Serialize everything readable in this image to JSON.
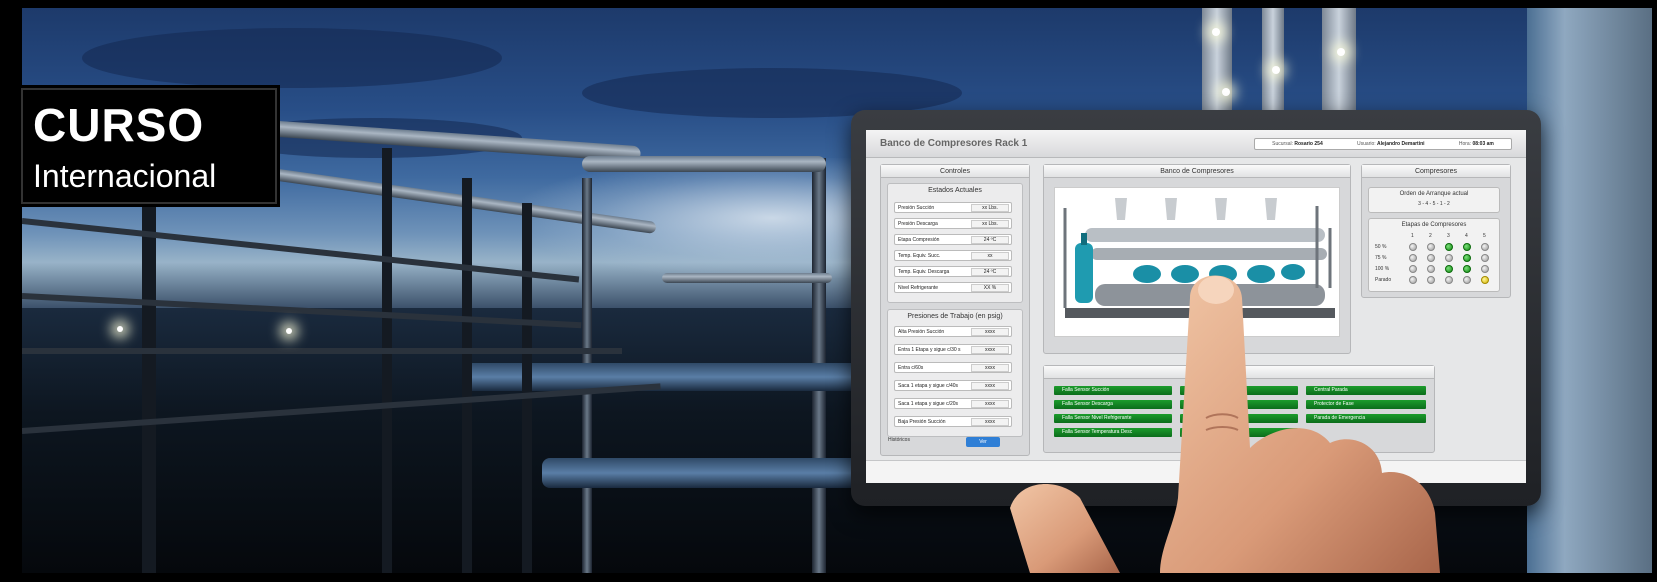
{
  "badge": {
    "title": "CURSO",
    "subtitle": "Internacional"
  },
  "app": {
    "title": "Banco de Compresores Rack 1",
    "info": {
      "sucursal_label": "Sucursal:",
      "sucursal": "Rosario 254",
      "usuario_label": "Usuario:",
      "usuario": "Alejandro Demartini",
      "hora_label": "Hora:",
      "hora": "08:03 am"
    }
  },
  "controles": {
    "title": "Controles",
    "estados": {
      "title": "Estados Actuales",
      "fields": [
        {
          "label": "Presión Succión",
          "value": "xx Lbs."
        },
        {
          "label": "Presión Descarga",
          "value": "xx Lbs."
        },
        {
          "label": "Etapa Compresión",
          "value": "24 ºC"
        },
        {
          "label": "Temp. Equiv. Succ.",
          "value": "xx"
        },
        {
          "label": "Temp. Equiv. Descarga",
          "value": "24 ºC"
        },
        {
          "label": "Nivel Refrigerante",
          "value": "XX %"
        }
      ]
    },
    "presiones": {
      "title": "Presiones de Trabajo (en psig)",
      "fields": [
        {
          "label": "Alta Presión Succión",
          "value": "xxxx"
        },
        {
          "label": "Entra 1 Etapa y sigue c/30 s",
          "value": "xxxx"
        },
        {
          "label": "Entra c/60s",
          "value": "xxxx"
        },
        {
          "label": "Saca 1 etapa y sigue c/40s",
          "value": "xxxx"
        },
        {
          "label": "Saca 1 etapa y sigue c/20s",
          "value": "xxxx"
        },
        {
          "label": "Baja Presión Succión",
          "value": "xxxx"
        }
      ]
    },
    "historicos_label": "Históricos",
    "ver_label": "Ver"
  },
  "banco": {
    "title": "Banco de Compresores"
  },
  "compresores": {
    "title": "Compresores",
    "orden_title": "Orden de Arranque actual",
    "orden_value": "3 - 4 - 5 - 1 - 2",
    "etapas_title": "Etapas de Compresores",
    "columns": [
      "1",
      "2",
      "3",
      "4",
      "5"
    ],
    "rows": [
      {
        "label": "50 %",
        "states": [
          "off",
          "off",
          "on",
          "on",
          "off"
        ]
      },
      {
        "label": "75 %",
        "states": [
          "off",
          "off",
          "off",
          "on",
          "off"
        ]
      },
      {
        "label": "100 %",
        "states": [
          "off",
          "off",
          "on",
          "on",
          "off"
        ]
      },
      {
        "label": "Parado",
        "states": [
          "off",
          "off",
          "off",
          "off",
          "warn"
        ]
      }
    ]
  },
  "alarms": {
    "col1": [
      "Falla Sensor Succión",
      "Falla Sensor Descarga",
      "Falla Sensor Nivel Refrigerante",
      "Falla Sensor Temperatura Desc"
    ],
    "col2": [
      "scrido",
      "scarga",
      "ccion",
      "arga"
    ],
    "col3": [
      "Central Parada",
      "Protector de Fase",
      "Parada de Emergencia"
    ],
    "partial_header": "s"
  },
  "colors": {
    "accent_blue": "#2f7fd6",
    "alarm_green": "#0b6d1b",
    "led_green": "#148c14",
    "led_yellow": "#d4b400"
  }
}
